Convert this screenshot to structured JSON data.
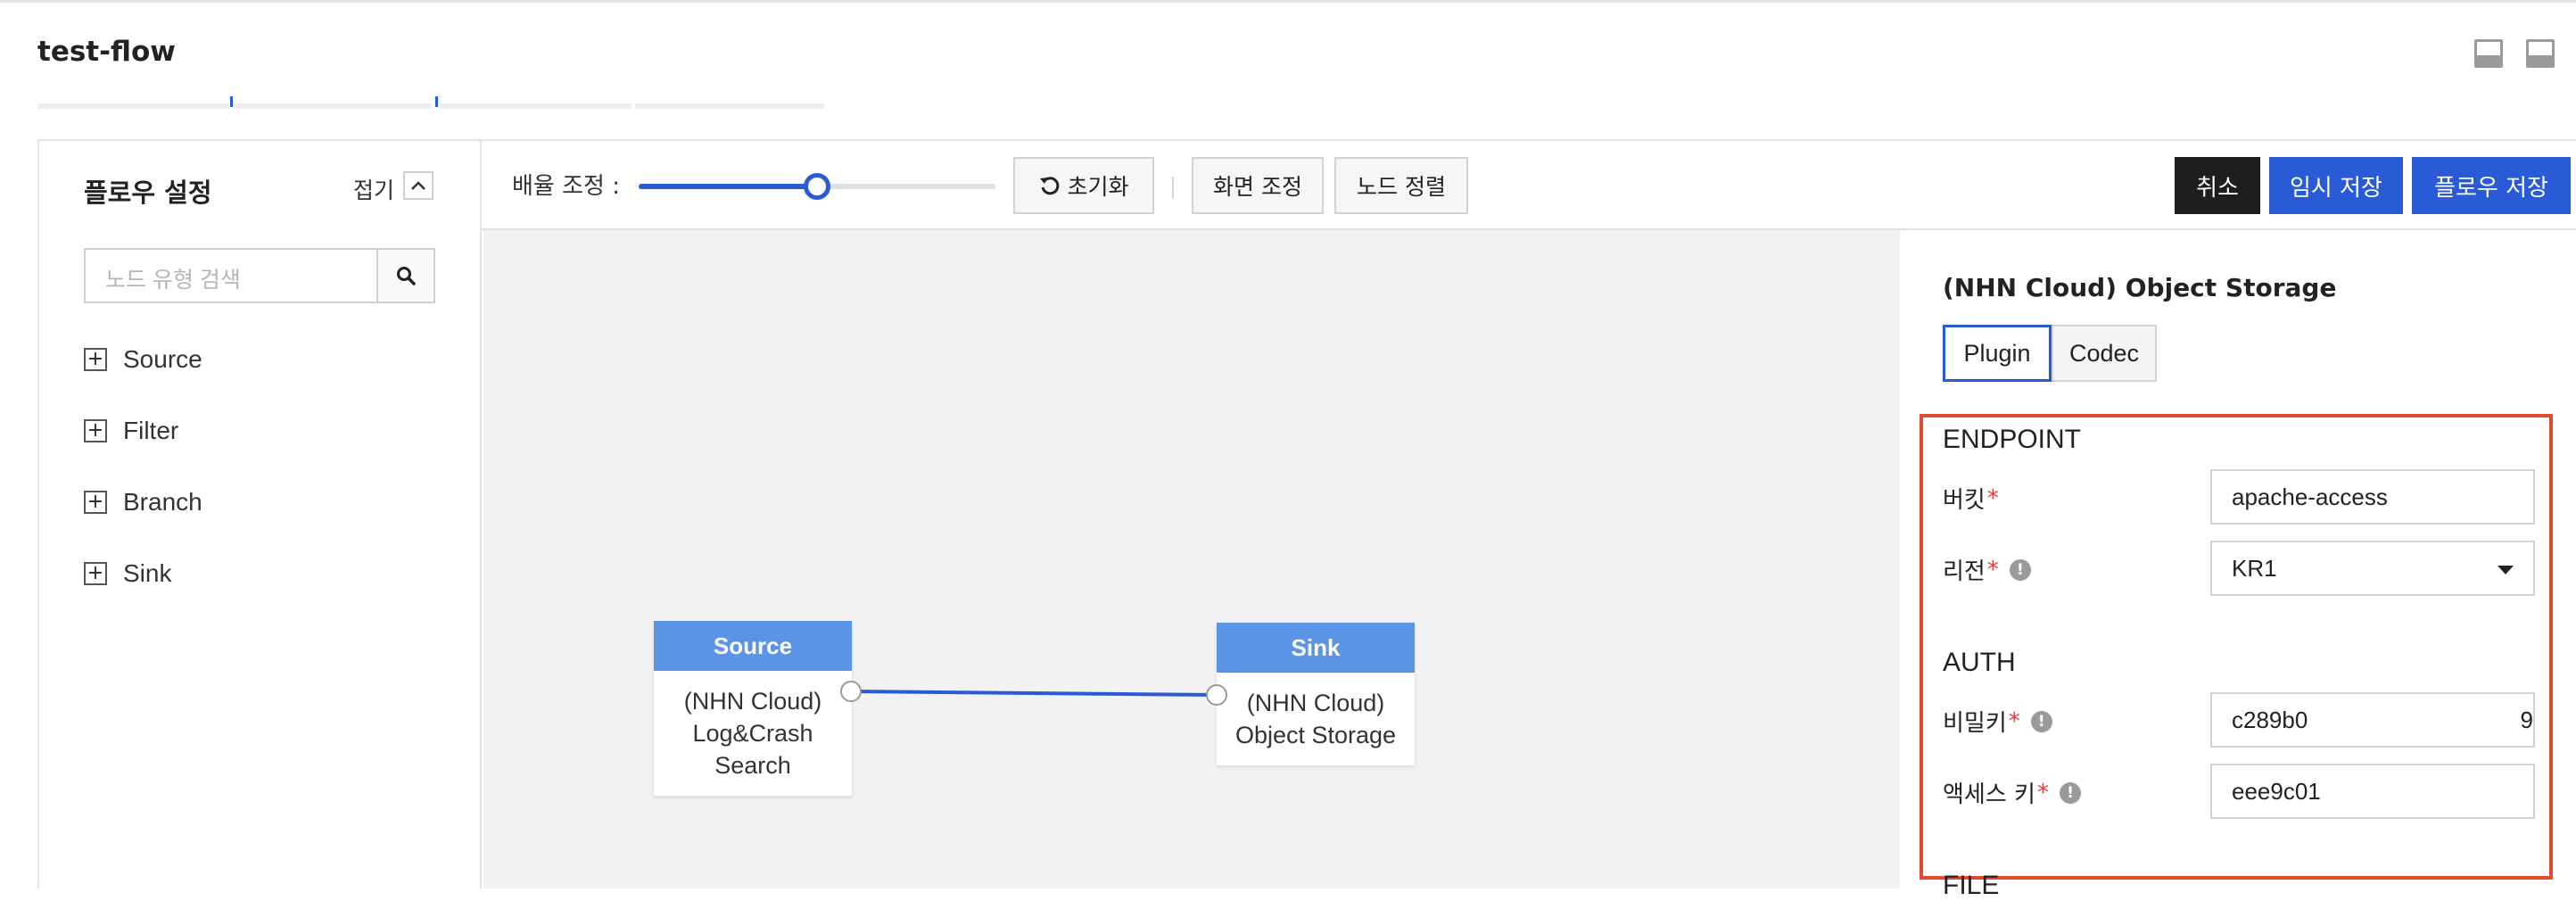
{
  "app": {
    "title": "test-flow"
  },
  "sidebar": {
    "title": "플로우 설정",
    "fold_label": "접기",
    "search_placeholder": "노드 유형 검색",
    "items": [
      {
        "label": "Source"
      },
      {
        "label": "Filter"
      },
      {
        "label": "Branch"
      },
      {
        "label": "Sink"
      }
    ]
  },
  "toolbar": {
    "zoom_label": "배율 조정 :",
    "zoom_level": 0.5,
    "reset_label": "초기화",
    "fit_label": "화면 조정",
    "align_label": "노드 정렬",
    "cancel_label": "취소",
    "temp_save_label": "임시 저장",
    "save_label": "플로우 저장",
    "colors": {
      "cancel": "#1e1e1e",
      "primary": "#2a5bd7"
    }
  },
  "canvas": {
    "nodes": [
      {
        "type": "Source",
        "name": "(NHN Cloud) Log&Crash Search",
        "lines": [
          "(NHN Cloud)",
          "Log&Crash",
          "Search"
        ]
      },
      {
        "type": "Sink",
        "name": "(NHN Cloud) Object Storage",
        "lines": [
          "(NHN Cloud)",
          "Object Storage"
        ]
      }
    ],
    "node_header_color": "#5b93e6",
    "edge_color": "#2a5bd7"
  },
  "detail": {
    "title": "(NHN Cloud) Object Storage",
    "tabs": [
      "Plugin",
      "Codec"
    ],
    "active_tab": "Plugin",
    "endpoint": {
      "heading": "ENDPOINT",
      "bucket_label": "버킷",
      "bucket_value": "apache-access",
      "region_label": "리전",
      "region_value": "KR1"
    },
    "auth": {
      "heading": "AUTH",
      "secret_label": "비밀키",
      "secret_value": "c289b0",
      "secret_trailing": "9",
      "access_label": "액세스 키",
      "access_value": "eee9c01"
    },
    "file_heading": "FILE",
    "highlight_color": "#e04a2f"
  }
}
